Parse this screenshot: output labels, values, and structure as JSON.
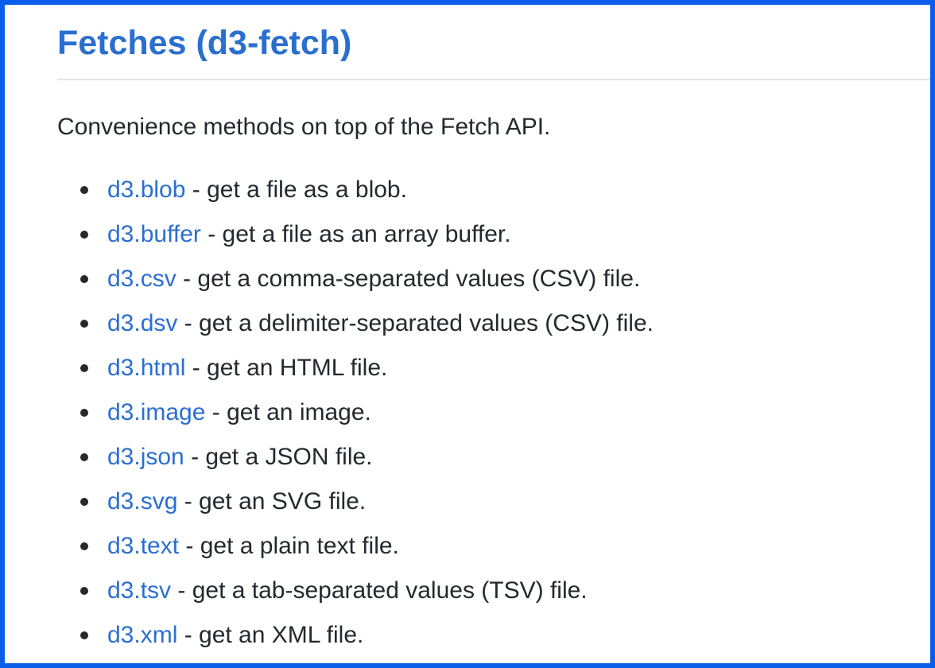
{
  "heading": "Fetches (d3-fetch)",
  "intro": "Convenience methods on top of the Fetch API.",
  "colors": {
    "frame_border": "#0a5de8",
    "link": "#2a6fd0",
    "text": "#24292e",
    "divider": "#e1e4e8"
  },
  "items": [
    {
      "link": "d3.blob",
      "desc": " - get a file as a blob."
    },
    {
      "link": "d3.buffer",
      "desc": " - get a file as an array buffer."
    },
    {
      "link": "d3.csv",
      "desc": " - get a comma-separated values (CSV) file."
    },
    {
      "link": "d3.dsv",
      "desc": " - get a delimiter-separated values (CSV) file."
    },
    {
      "link": "d3.html",
      "desc": " - get an HTML file."
    },
    {
      "link": "d3.image",
      "desc": " - get an image."
    },
    {
      "link": "d3.json",
      "desc": " - get a JSON file."
    },
    {
      "link": "d3.svg",
      "desc": " - get an SVG file."
    },
    {
      "link": "d3.text",
      "desc": " - get a plain text file."
    },
    {
      "link": "d3.tsv",
      "desc": " - get a tab-separated values (TSV) file."
    },
    {
      "link": "d3.xml",
      "desc": " - get an XML file."
    }
  ]
}
